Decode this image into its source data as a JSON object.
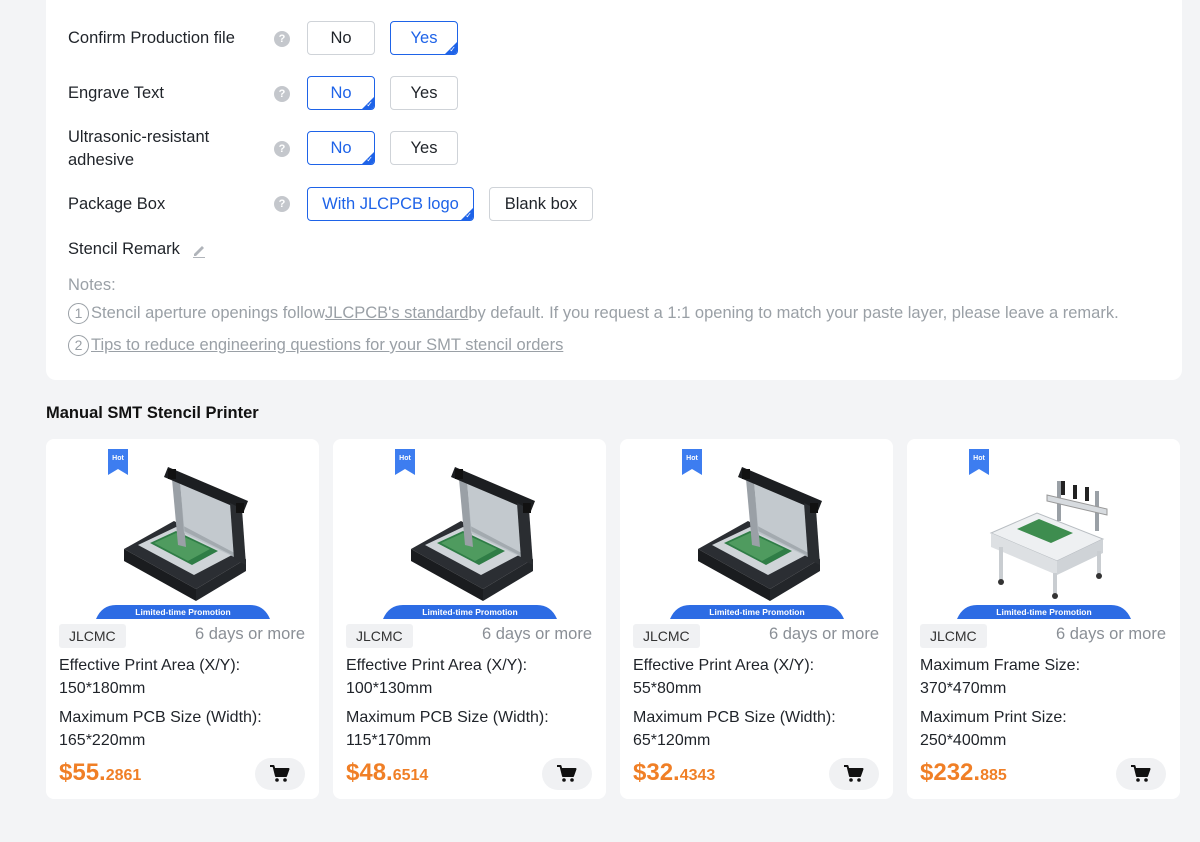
{
  "options": [
    {
      "label": "Confirm Production file",
      "choices": [
        "No",
        "Yes"
      ],
      "selected": 1
    },
    {
      "label": "Engrave Text",
      "choices": [
        "No",
        "Yes"
      ],
      "selected": 0
    },
    {
      "label": "Ultrasonic-resistant adhesive",
      "choices": [
        "No",
        "Yes"
      ],
      "selected": 0
    },
    {
      "label": "Package Box",
      "choices": [
        "With JLCPCB logo",
        "Blank box"
      ],
      "selected": 0
    }
  ],
  "help_glyph": "?",
  "remark": {
    "label": "Stencil Remark"
  },
  "notes": {
    "title": "Notes:",
    "n1_num": "1",
    "n1_pre": "Stencil aperture openings follow ",
    "n1_link": "JLCPCB's standard ",
    "n1_post": "by default. If you request a 1:1 opening to match your paste layer, please leave a remark.",
    "n2_num": "2",
    "n2_link": "Tips to reduce engineering questions for your SMT stencil orders"
  },
  "section_title": "Manual SMT Stencil Printer",
  "products": [
    {
      "hot": "Hot",
      "promo": "Limited-time Promotion",
      "vendor": "JLCMC",
      "lead": "6 days or more",
      "spec1_label": "Effective Print Area (X/Y):",
      "spec1_value": "150*180mm",
      "spec2_label": "Maximum PCB Size (Width):",
      "spec2_value": "165*220mm",
      "price_int": "$55.",
      "price_dec": "2861",
      "image": "stencil-printer-black"
    },
    {
      "hot": "Hot",
      "promo": "Limited-time Promotion",
      "vendor": "JLCMC",
      "lead": "6 days or more",
      "spec1_label": "Effective Print Area (X/Y):",
      "spec1_value": "100*130mm",
      "spec2_label": "Maximum PCB Size (Width):",
      "spec2_value": "115*170mm",
      "price_int": "$48.",
      "price_dec": "6514",
      "image": "stencil-printer-black"
    },
    {
      "hot": "Hot",
      "promo": "Limited-time Promotion",
      "vendor": "JLCMC",
      "lead": "6 days or more",
      "spec1_label": "Effective Print Area (X/Y):",
      "spec1_value": "55*80mm",
      "spec2_label": "Maximum PCB Size (Width):",
      "spec2_value": "65*120mm",
      "price_int": "$32.",
      "price_dec": "4343",
      "image": "stencil-printer-black"
    },
    {
      "hot": "Hot",
      "promo": "Limited-time Promotion",
      "vendor": "JLCMC",
      "lead": "6 days or more",
      "spec1_label": "Maximum Frame Size:",
      "spec1_value": "370*470mm",
      "spec2_label": "Maximum Print Size:",
      "spec2_value": "250*400mm",
      "price_int": "$232.",
      "price_dec": "885",
      "image": "stencil-printer-white"
    }
  ],
  "colors": {
    "accent": "#1e63e8",
    "price": "#f07f26",
    "background": "#f3f4f6"
  }
}
